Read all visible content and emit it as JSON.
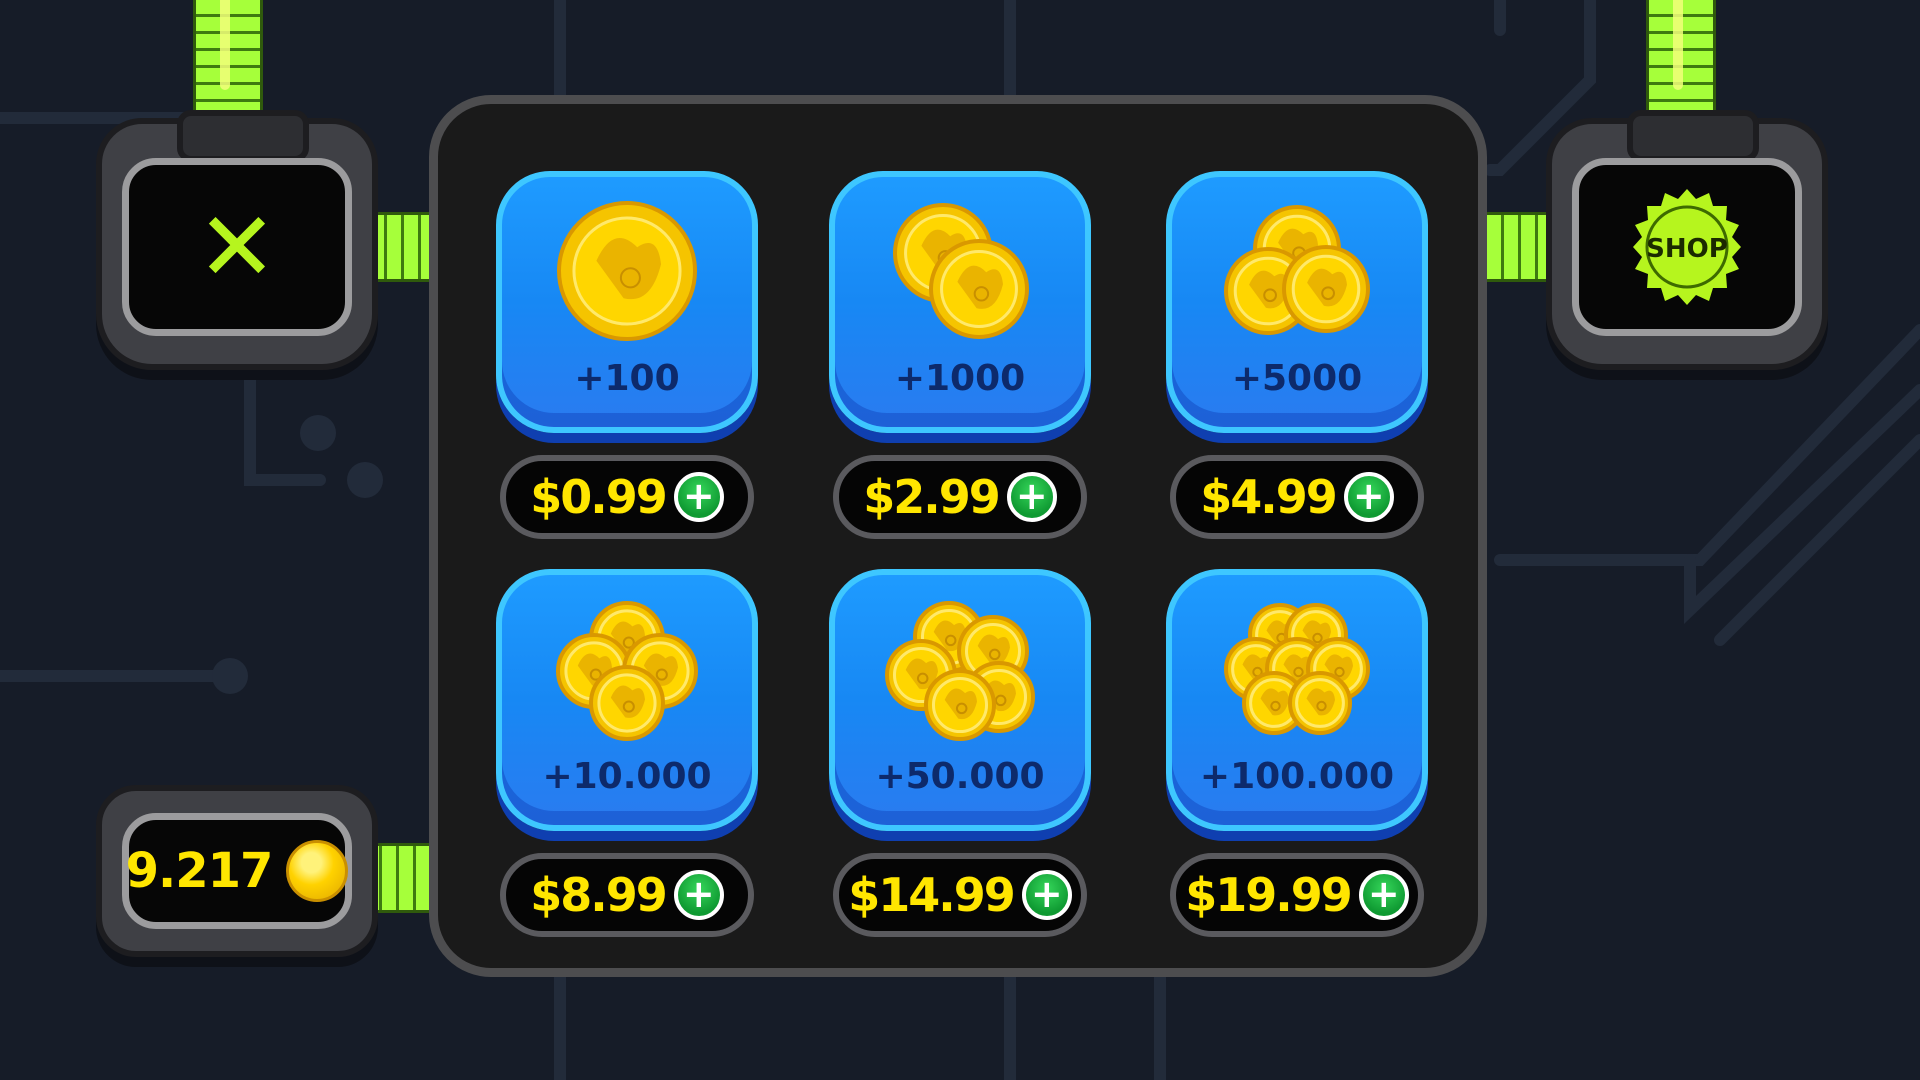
{
  "header": {
    "close_icon": "close-x-icon",
    "shop_label": "SHOP"
  },
  "balance": {
    "value": "9.217",
    "icon": "coin-icon"
  },
  "shop": {
    "items": [
      {
        "amount": "+100",
        "price": "$0.99",
        "coins": 1
      },
      {
        "amount": "+1000",
        "price": "$2.99",
        "coins": 2
      },
      {
        "amount": "+5000",
        "price": "$4.99",
        "coins": 3
      },
      {
        "amount": "+10.000",
        "price": "$8.99",
        "coins": 4
      },
      {
        "amount": "+50.000",
        "price": "$14.99",
        "coins": 5
      },
      {
        "amount": "+100.000",
        "price": "$19.99",
        "coins": 7
      }
    ],
    "add_symbol": "+"
  },
  "colors": {
    "background": "#161c28",
    "accent_green": "#b6f51e",
    "coin_gold": "#ffd200",
    "tile_blue": "#1e9bff",
    "price_yellow": "#ffe600",
    "plus_green": "#1fb444"
  }
}
